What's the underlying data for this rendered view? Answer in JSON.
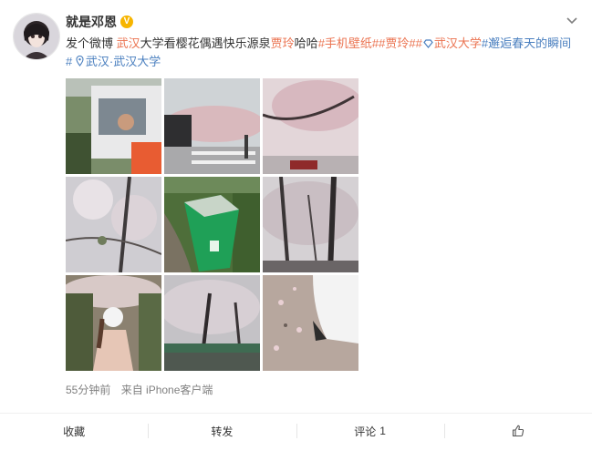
{
  "user": {
    "name": "就是邓恩",
    "verified_badge": "V"
  },
  "post": {
    "segments": [
      {
        "text": "发个微博 ",
        "style": "plain"
      },
      {
        "text": "武汉",
        "style": "hl"
      },
      {
        "text": "大学看樱花偶遇快乐源泉",
        "style": "plain"
      },
      {
        "text": "贾玲",
        "style": "hl"
      },
      {
        "text": "哈哈",
        "style": "plain"
      },
      {
        "text": "#手机壁纸#",
        "style": "tag"
      },
      {
        "text": "#贾玲#",
        "style": "tag"
      },
      {
        "text": "#",
        "style": "tag"
      },
      {
        "text": "武汉大学",
        "style": "tag-icon"
      },
      {
        "text": "#邂逅春天的瞬间#",
        "style": "lnk"
      }
    ],
    "location": "武汉·武汉大学"
  },
  "meta": {
    "time": "55分钟前",
    "source": "来自 iPhone客户端"
  },
  "actions": {
    "favorite": "收藏",
    "repost": "转发",
    "comment": "评论",
    "comment_count": "1"
  },
  "icons": {
    "more": "chevron-down-icon",
    "location": "location-pin-icon",
    "like": "thumbs-up-icon",
    "tag_icon": "diamond-icon"
  },
  "colors": {
    "highlight": "#eb7350",
    "link": "#4a7fbf",
    "badge": "#f7b500"
  },
  "images": [
    "photo-truck-window",
    "photo-street-cherry-trees",
    "photo-cherry-branches",
    "photo-blossom-close",
    "photo-green-trash-bin",
    "photo-tree-trunks",
    "photo-girl-cherry-tree",
    "photo-cherry-trees-lake",
    "photo-petals-ground"
  ]
}
